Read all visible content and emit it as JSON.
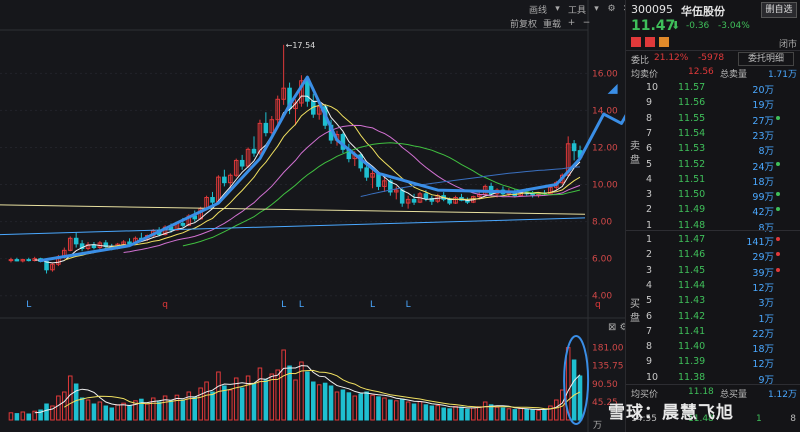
{
  "toolbar": {
    "draw_label": "画线",
    "tools_label": "工具",
    "fq_label": "前复权",
    "fq_sym": "重载",
    "top_icons": [
      "settings-icon",
      "close-icon"
    ]
  },
  "stock": {
    "code": "300095",
    "name": "华伍股份",
    "add_watch": "删自选",
    "price": "11.47",
    "arrow": "⬇",
    "change": "-0.36",
    "change_pct": "-3.04%",
    "status": "闭市"
  },
  "order_summary": {
    "wb_label": "委比",
    "wb_value": "21.12%",
    "wc_value": "-5978",
    "entrust_btn": "委托明细",
    "sell_avg_label": "均卖价",
    "sell_avg_value": "12.56",
    "sell_total_label": "总卖量",
    "sell_total_value": "1.71万",
    "sell_side_label": "卖盘",
    "buy_side_label": "买盘",
    "buy_avg_label": "均买价",
    "buy_avg_value": "11.18",
    "buy_total_label": "总买量",
    "buy_total_value": "1.12万",
    "time": "14:55",
    "last_px": "11.48",
    "last_vol": "1",
    "last_cnt": "8"
  },
  "sell_orders": [
    {
      "idx": "10",
      "price": "11.57",
      "vol": "20万",
      "dot": false
    },
    {
      "idx": "9",
      "price": "11.56",
      "vol": "19万",
      "dot": false
    },
    {
      "idx": "8",
      "price": "11.55",
      "vol": "27万",
      "dot": true
    },
    {
      "idx": "7",
      "price": "11.54",
      "vol": "23万",
      "dot": false
    },
    {
      "idx": "6",
      "price": "11.53",
      "vol": "8万",
      "dot": false
    },
    {
      "idx": "5",
      "price": "11.52",
      "vol": "24万",
      "dot": true
    },
    {
      "idx": "4",
      "price": "11.51",
      "vol": "18万",
      "dot": false
    },
    {
      "idx": "3",
      "price": "11.50",
      "vol": "99万",
      "dot": true
    },
    {
      "idx": "2",
      "price": "11.49",
      "vol": "42万",
      "dot": true
    },
    {
      "idx": "1",
      "price": "11.48",
      "vol": "8万",
      "dot": false
    }
  ],
  "buy_orders": [
    {
      "idx": "1",
      "price": "11.47",
      "vol": "141万",
      "dot": true
    },
    {
      "idx": "2",
      "price": "11.46",
      "vol": "29万",
      "dot": true
    },
    {
      "idx": "3",
      "price": "11.45",
      "vol": "39万",
      "dot": true
    },
    {
      "idx": "4",
      "price": "11.44",
      "vol": "12万",
      "dot": false
    },
    {
      "idx": "5",
      "price": "11.43",
      "vol": "3万",
      "dot": false
    },
    {
      "idx": "6",
      "price": "11.42",
      "vol": "1万",
      "dot": false
    },
    {
      "idx": "7",
      "price": "11.41",
      "vol": "22万",
      "dot": false
    },
    {
      "idx": "8",
      "price": "11.40",
      "vol": "18万",
      "dot": false
    },
    {
      "idx": "9",
      "price": "11.39",
      "vol": "12万",
      "dot": false
    },
    {
      "idx": "10",
      "price": "11.38",
      "vol": "9万",
      "dot": false
    }
  ],
  "chart_labels": {
    "high_label": "←17.54",
    "bottom_markers": [
      "L",
      "q",
      "L",
      "L",
      "L",
      "L",
      "q"
    ],
    "vol_unit": "万",
    "watermark": "雪球：晨慧飞旭"
  },
  "colors": {
    "up": "#e0393a",
    "down": "#1fbfd0",
    "accent": "#3a8ee6",
    "green": "#3fbf5a",
    "bg": "#16171b"
  },
  "chart_data": {
    "type": "candlestick",
    "price_axis": {
      "ticks": [
        16.0,
        14.0,
        12.0,
        10.0,
        8.0,
        6.0,
        4.0
      ],
      "ylim": [
        3.5,
        17.8
      ]
    },
    "volume_axis": {
      "ticks": [
        181.0,
        135.75,
        90.5,
        45.25
      ],
      "unit": "万"
    },
    "high_value": 17.54,
    "candles": [
      {
        "o": 5.9,
        "h": 6.05,
        "l": 5.8,
        "c": 5.95,
        "v": 18
      },
      {
        "o": 5.95,
        "h": 6.05,
        "l": 5.85,
        "c": 5.88,
        "v": 16
      },
      {
        "o": 5.88,
        "h": 6.0,
        "l": 5.8,
        "c": 5.95,
        "v": 20
      },
      {
        "o": 5.95,
        "h": 6.05,
        "l": 5.85,
        "c": 5.9,
        "v": 15
      },
      {
        "o": 5.9,
        "h": 6.1,
        "l": 5.85,
        "c": 6.0,
        "v": 22
      },
      {
        "o": 6.0,
        "h": 6.05,
        "l": 5.8,
        "c": 5.85,
        "v": 25
      },
      {
        "o": 5.85,
        "h": 6.0,
        "l": 5.2,
        "c": 5.4,
        "v": 40
      },
      {
        "o": 5.4,
        "h": 5.75,
        "l": 5.3,
        "c": 5.7,
        "v": 35
      },
      {
        "o": 5.7,
        "h": 6.2,
        "l": 5.6,
        "c": 6.1,
        "v": 60
      },
      {
        "o": 6.1,
        "h": 6.6,
        "l": 6.0,
        "c": 6.45,
        "v": 70
      },
      {
        "o": 6.45,
        "h": 7.2,
        "l": 6.4,
        "c": 7.1,
        "v": 110
      },
      {
        "o": 7.1,
        "h": 7.4,
        "l": 6.6,
        "c": 6.8,
        "v": 90
      },
      {
        "o": 6.8,
        "h": 7.0,
        "l": 6.4,
        "c": 6.55,
        "v": 55
      },
      {
        "o": 6.55,
        "h": 6.9,
        "l": 6.45,
        "c": 6.75,
        "v": 50
      },
      {
        "o": 6.75,
        "h": 6.9,
        "l": 6.5,
        "c": 6.6,
        "v": 40
      },
      {
        "o": 6.6,
        "h": 6.95,
        "l": 6.5,
        "c": 6.85,
        "v": 45
      },
      {
        "o": 6.85,
        "h": 7.0,
        "l": 6.55,
        "c": 6.65,
        "v": 35
      },
      {
        "o": 6.65,
        "h": 6.8,
        "l": 6.45,
        "c": 6.55,
        "v": 30
      },
      {
        "o": 6.55,
        "h": 6.85,
        "l": 6.5,
        "c": 6.78,
        "v": 38
      },
      {
        "o": 6.78,
        "h": 7.0,
        "l": 6.6,
        "c": 6.9,
        "v": 42
      },
      {
        "o": 6.9,
        "h": 7.1,
        "l": 6.7,
        "c": 6.8,
        "v": 36
      },
      {
        "o": 6.8,
        "h": 7.2,
        "l": 6.75,
        "c": 7.1,
        "v": 48
      },
      {
        "o": 7.1,
        "h": 7.4,
        "l": 6.95,
        "c": 7.05,
        "v": 52
      },
      {
        "o": 7.05,
        "h": 7.3,
        "l": 6.95,
        "c": 7.25,
        "v": 40
      },
      {
        "o": 7.25,
        "h": 7.6,
        "l": 7.15,
        "c": 7.5,
        "v": 55
      },
      {
        "o": 7.5,
        "h": 7.7,
        "l": 7.2,
        "c": 7.3,
        "v": 45
      },
      {
        "o": 7.3,
        "h": 7.8,
        "l": 7.25,
        "c": 7.7,
        "v": 60
      },
      {
        "o": 7.7,
        "h": 7.9,
        "l": 7.4,
        "c": 7.55,
        "v": 48
      },
      {
        "o": 7.55,
        "h": 8.0,
        "l": 7.5,
        "c": 7.9,
        "v": 62
      },
      {
        "o": 7.9,
        "h": 8.2,
        "l": 7.7,
        "c": 7.8,
        "v": 50
      },
      {
        "o": 7.8,
        "h": 8.4,
        "l": 7.75,
        "c": 8.3,
        "v": 70
      },
      {
        "o": 8.3,
        "h": 8.6,
        "l": 8.0,
        "c": 8.15,
        "v": 58
      },
      {
        "o": 8.15,
        "h": 8.8,
        "l": 8.1,
        "c": 8.7,
        "v": 80
      },
      {
        "o": 8.7,
        "h": 9.4,
        "l": 8.6,
        "c": 9.3,
        "v": 95
      },
      {
        "o": 9.3,
        "h": 9.6,
        "l": 8.9,
        "c": 9.05,
        "v": 70
      },
      {
        "o": 9.05,
        "h": 10.5,
        "l": 9.0,
        "c": 10.4,
        "v": 120
      },
      {
        "o": 10.4,
        "h": 10.8,
        "l": 9.9,
        "c": 10.1,
        "v": 85
      },
      {
        "o": 10.1,
        "h": 10.6,
        "l": 9.8,
        "c": 10.5,
        "v": 75
      },
      {
        "o": 10.5,
        "h": 11.4,
        "l": 10.4,
        "c": 11.3,
        "v": 105
      },
      {
        "o": 11.3,
        "h": 11.6,
        "l": 10.8,
        "c": 11.0,
        "v": 80
      },
      {
        "o": 11.0,
        "h": 12.0,
        "l": 10.9,
        "c": 11.9,
        "v": 110
      },
      {
        "o": 11.9,
        "h": 12.6,
        "l": 11.5,
        "c": 11.7,
        "v": 90
      },
      {
        "o": 11.7,
        "h": 13.5,
        "l": 11.6,
        "c": 13.3,
        "v": 130
      },
      {
        "o": 13.3,
        "h": 13.9,
        "l": 12.6,
        "c": 12.8,
        "v": 100
      },
      {
        "o": 12.8,
        "h": 13.7,
        "l": 12.5,
        "c": 13.5,
        "v": 115
      },
      {
        "o": 13.5,
        "h": 14.8,
        "l": 13.2,
        "c": 14.6,
        "v": 125
      },
      {
        "o": 14.6,
        "h": 17.54,
        "l": 14.3,
        "c": 15.2,
        "v": 175
      },
      {
        "o": 15.2,
        "h": 15.5,
        "l": 13.8,
        "c": 14.1,
        "v": 135
      },
      {
        "o": 14.1,
        "h": 14.6,
        "l": 13.2,
        "c": 14.4,
        "v": 100
      },
      {
        "o": 14.4,
        "h": 15.9,
        "l": 14.2,
        "c": 15.6,
        "v": 145
      },
      {
        "o": 15.6,
        "h": 15.8,
        "l": 14.2,
        "c": 14.5,
        "v": 120
      },
      {
        "o": 14.5,
        "h": 14.9,
        "l": 13.6,
        "c": 13.8,
        "v": 95
      },
      {
        "o": 13.8,
        "h": 14.4,
        "l": 13.5,
        "c": 14.2,
        "v": 88
      },
      {
        "o": 14.2,
        "h": 14.3,
        "l": 13.0,
        "c": 13.2,
        "v": 92
      },
      {
        "o": 13.2,
        "h": 13.5,
        "l": 12.2,
        "c": 12.4,
        "v": 85
      },
      {
        "o": 12.4,
        "h": 12.9,
        "l": 12.1,
        "c": 12.7,
        "v": 70
      },
      {
        "o": 12.7,
        "h": 12.8,
        "l": 11.7,
        "c": 11.9,
        "v": 75
      },
      {
        "o": 11.9,
        "h": 12.2,
        "l": 11.2,
        "c": 11.4,
        "v": 68
      },
      {
        "o": 11.4,
        "h": 11.8,
        "l": 11.0,
        "c": 11.6,
        "v": 60
      },
      {
        "o": 11.6,
        "h": 11.7,
        "l": 10.7,
        "c": 10.9,
        "v": 65
      },
      {
        "o": 10.9,
        "h": 11.2,
        "l": 10.2,
        "c": 10.4,
        "v": 70
      },
      {
        "o": 10.4,
        "h": 10.8,
        "l": 9.8,
        "c": 10.6,
        "v": 62
      },
      {
        "o": 10.6,
        "h": 10.7,
        "l": 9.7,
        "c": 9.9,
        "v": 58
      },
      {
        "o": 9.9,
        "h": 10.4,
        "l": 9.6,
        "c": 10.2,
        "v": 55
      },
      {
        "o": 10.2,
        "h": 10.3,
        "l": 9.4,
        "c": 9.6,
        "v": 50
      },
      {
        "o": 9.6,
        "h": 9.9,
        "l": 9.2,
        "c": 9.7,
        "v": 48
      },
      {
        "o": 9.7,
        "h": 9.8,
        "l": 8.8,
        "c": 9.0,
        "v": 52
      },
      {
        "o": 9.0,
        "h": 9.4,
        "l": 8.7,
        "c": 9.2,
        "v": 45
      },
      {
        "o": 9.2,
        "h": 9.5,
        "l": 8.9,
        "c": 9.05,
        "v": 40
      },
      {
        "o": 9.05,
        "h": 9.6,
        "l": 9.0,
        "c": 9.5,
        "v": 46
      },
      {
        "o": 9.5,
        "h": 9.7,
        "l": 9.1,
        "c": 9.25,
        "v": 38
      },
      {
        "o": 9.25,
        "h": 9.4,
        "l": 8.9,
        "c": 9.1,
        "v": 35
      },
      {
        "o": 9.1,
        "h": 9.5,
        "l": 9.0,
        "c": 9.4,
        "v": 36
      },
      {
        "o": 9.4,
        "h": 9.6,
        "l": 9.1,
        "c": 9.2,
        "v": 30
      },
      {
        "o": 9.2,
        "h": 9.3,
        "l": 8.9,
        "c": 9.0,
        "v": 28
      },
      {
        "o": 9.0,
        "h": 9.4,
        "l": 8.95,
        "c": 9.3,
        "v": 34
      },
      {
        "o": 9.3,
        "h": 9.5,
        "l": 9.1,
        "c": 9.15,
        "v": 32
      },
      {
        "o": 9.15,
        "h": 9.3,
        "l": 8.95,
        "c": 9.05,
        "v": 27
      },
      {
        "o": 9.05,
        "h": 9.4,
        "l": 9.0,
        "c": 9.35,
        "v": 30
      },
      {
        "o": 9.35,
        "h": 9.6,
        "l": 9.2,
        "c": 9.45,
        "v": 33
      },
      {
        "o": 9.45,
        "h": 10.0,
        "l": 9.4,
        "c": 9.9,
        "v": 45
      },
      {
        "o": 9.9,
        "h": 10.1,
        "l": 9.4,
        "c": 9.5,
        "v": 38
      },
      {
        "o": 9.5,
        "h": 9.8,
        "l": 9.3,
        "c": 9.7,
        "v": 32
      },
      {
        "o": 9.7,
        "h": 9.9,
        "l": 9.4,
        "c": 9.5,
        "v": 30
      },
      {
        "o": 9.5,
        "h": 9.8,
        "l": 9.35,
        "c": 9.65,
        "v": 28
      },
      {
        "o": 9.65,
        "h": 9.75,
        "l": 9.3,
        "c": 9.4,
        "v": 26
      },
      {
        "o": 9.4,
        "h": 9.7,
        "l": 9.35,
        "c": 9.6,
        "v": 29
      },
      {
        "o": 9.6,
        "h": 9.8,
        "l": 9.4,
        "c": 9.5,
        "v": 27
      },
      {
        "o": 9.5,
        "h": 9.65,
        "l": 9.3,
        "c": 9.45,
        "v": 25
      },
      {
        "o": 9.45,
        "h": 9.6,
        "l": 9.3,
        "c": 9.55,
        "v": 24
      },
      {
        "o": 9.55,
        "h": 9.7,
        "l": 9.4,
        "c": 9.5,
        "v": 26
      },
      {
        "o": 9.5,
        "h": 9.9,
        "l": 9.45,
        "c": 9.85,
        "v": 35
      },
      {
        "o": 9.85,
        "h": 10.2,
        "l": 9.7,
        "c": 10.1,
        "v": 50
      },
      {
        "o": 10.1,
        "h": 10.6,
        "l": 10.0,
        "c": 10.5,
        "v": 75
      },
      {
        "o": 10.5,
        "h": 12.6,
        "l": 10.4,
        "c": 12.2,
        "v": 181
      },
      {
        "o": 12.2,
        "h": 12.4,
        "l": 11.3,
        "c": 11.83,
        "v": 150
      },
      {
        "o": 11.83,
        "h": 12.1,
        "l": 11.4,
        "c": 11.47,
        "v": 110
      }
    ]
  }
}
